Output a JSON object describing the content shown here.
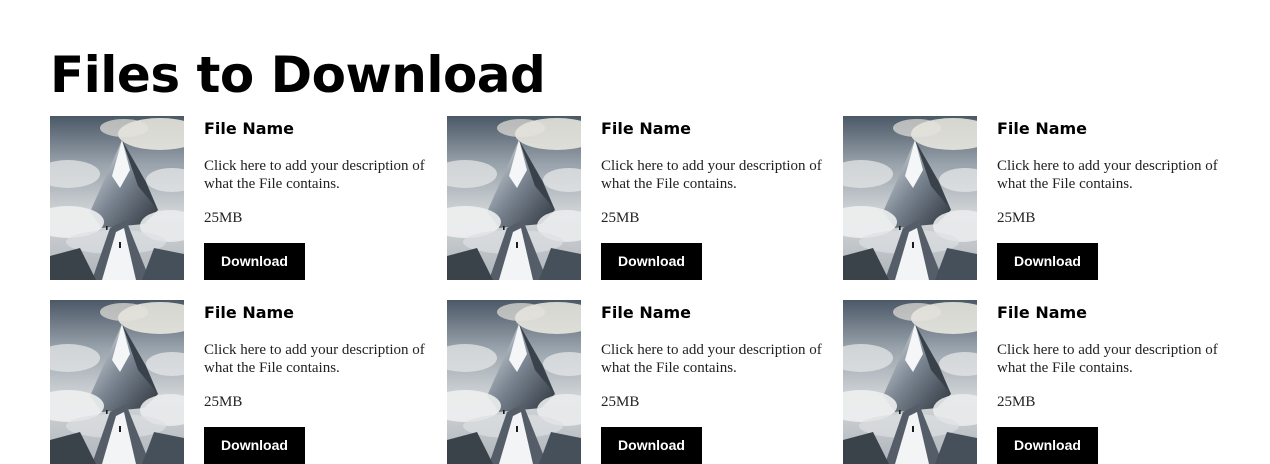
{
  "page": {
    "title": "Files to Download"
  },
  "files": [
    {
      "name": "File Name",
      "description": "Click here to add your description of what the File contains.",
      "size": "25MB",
      "button_label": "Download"
    },
    {
      "name": "File Name",
      "description": "Click here to add your description of what the File contains.",
      "size": "25MB",
      "button_label": "Download"
    },
    {
      "name": "File Name",
      "description": "Click here to add your description of what the File contains.",
      "size": "25MB",
      "button_label": "Download"
    },
    {
      "name": "File Name",
      "description": "Click here to add your description of what the File contains.",
      "size": "25MB",
      "button_label": "Download"
    },
    {
      "name": "File Name",
      "description": "Click here to add your description of what the File contains.",
      "size": "25MB",
      "button_label": "Download"
    },
    {
      "name": "File Name",
      "description": "Click here to add your description of what the File contains.",
      "size": "25MB",
      "button_label": "Download"
    }
  ],
  "colors": {
    "button_background": "#000000",
    "button_text": "#ffffff",
    "title_text": "#000000"
  }
}
